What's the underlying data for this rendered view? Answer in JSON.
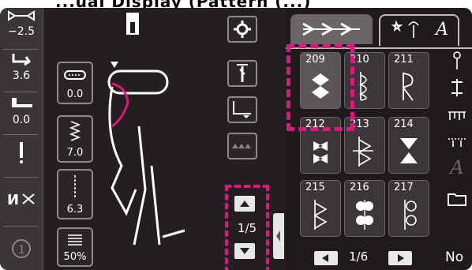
{
  "header": {
    "title": "...ual Display (Pattern (...)"
  },
  "left_strip": {
    "width_label": "−2.5",
    "tension_label": "3.6",
    "presser_label": "0.0"
  },
  "settings": {
    "width_value": "0.0",
    "length_value": "7.0",
    "tension_value": "6.3",
    "density_value": "50%"
  },
  "pager_left": {
    "page": "1/5"
  },
  "tabs": {
    "tab2_label": "A"
  },
  "patterns": [
    {
      "num": "209"
    },
    {
      "num": "210"
    },
    {
      "num": "211"
    },
    {
      "num": "212"
    },
    {
      "num": "213"
    },
    {
      "num": "214"
    },
    {
      "num": "215"
    },
    {
      "num": "216"
    },
    {
      "num": "217"
    }
  ],
  "pager_right": {
    "page": "1/6"
  },
  "right_side": {
    "a_label": "A",
    "no_label": "No"
  },
  "colors": {
    "highlight": "#e0157d",
    "screen_bg": "#231f20"
  }
}
